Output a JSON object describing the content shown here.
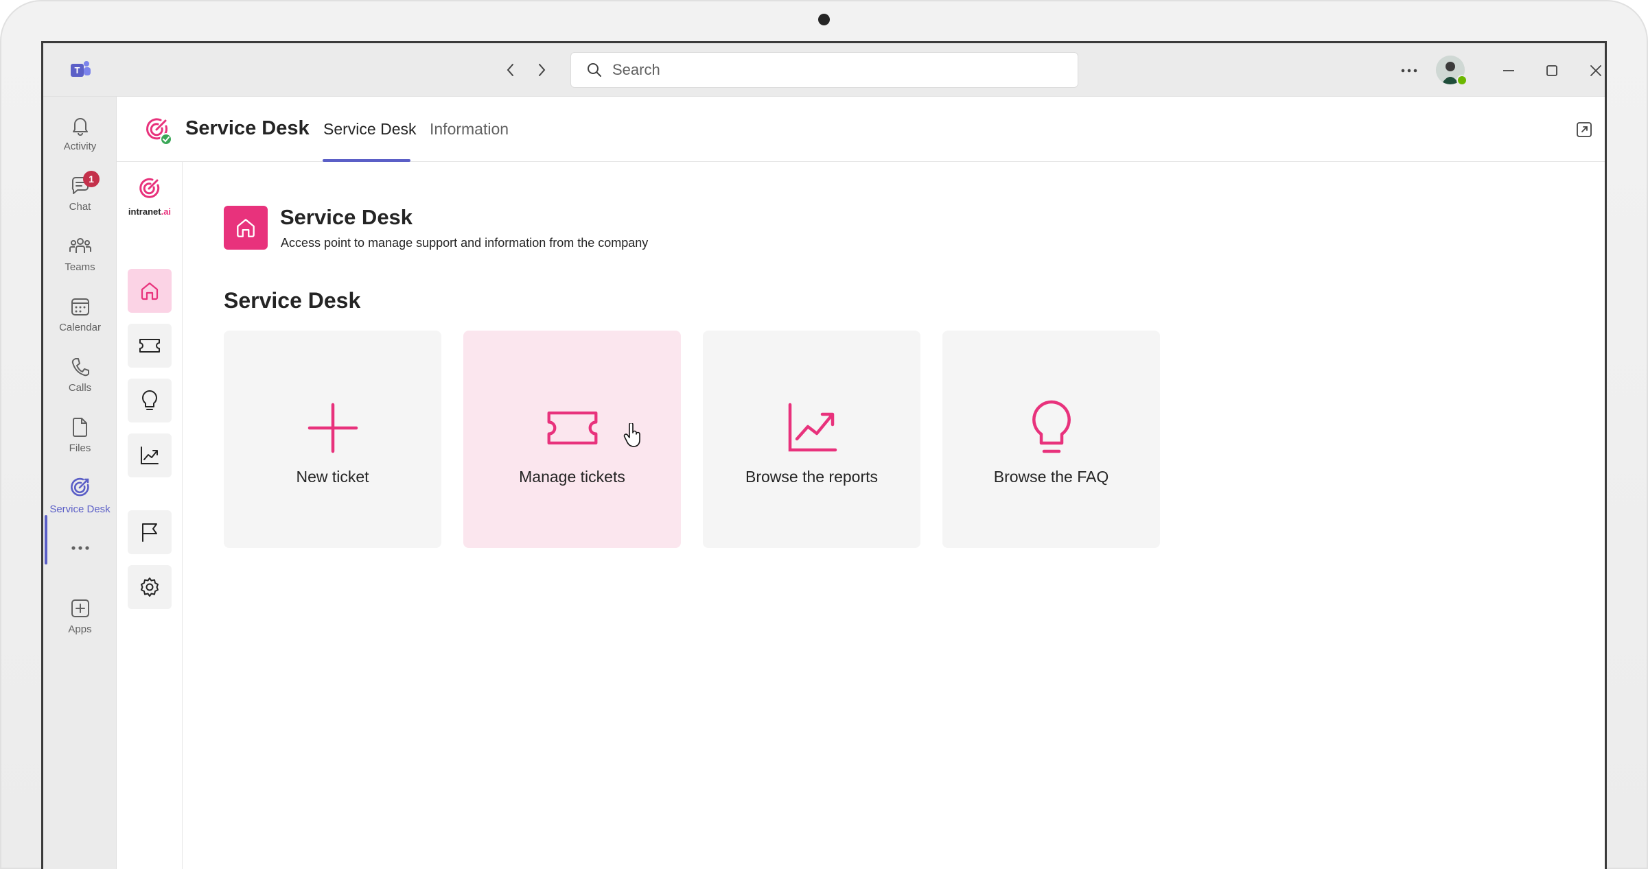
{
  "titlebar": {
    "search_placeholder": "Search"
  },
  "rail": {
    "items": [
      {
        "label": "Activity",
        "icon": "bell-icon"
      },
      {
        "label": "Chat",
        "icon": "chat-icon",
        "badge": "1"
      },
      {
        "label": "Teams",
        "icon": "teams-icon"
      },
      {
        "label": "Calendar",
        "icon": "calendar-icon"
      },
      {
        "label": "Calls",
        "icon": "phone-icon"
      },
      {
        "label": "Files",
        "icon": "file-icon"
      },
      {
        "label": "Service Desk",
        "icon": "service-desk-icon",
        "active": true
      },
      {
        "label": "Apps",
        "icon": "plus-square-icon"
      }
    ]
  },
  "app_header": {
    "title": "Service Desk",
    "tabs": [
      {
        "label": "Service Desk",
        "active": true
      },
      {
        "label": "Information",
        "active": false
      }
    ]
  },
  "brand": {
    "name_prefix": "intranet",
    "name_suffix": ".ai"
  },
  "page": {
    "title": "Service Desk",
    "subtitle": "Access point to manage support and information from the company",
    "section_title": "Service Desk",
    "cards": [
      {
        "label": "New ticket",
        "icon": "plus-icon"
      },
      {
        "label": "Manage tickets",
        "icon": "ticket-icon",
        "hovered": true
      },
      {
        "label": "Browse the reports",
        "icon": "chart-trend-icon"
      },
      {
        "label": "Browse the FAQ",
        "icon": "lightbulb-icon"
      }
    ]
  },
  "colors": {
    "accent": "#e8327c",
    "teams_purple": "#5b5fc7",
    "badge": "#c4314b",
    "presence": "#6bb700"
  }
}
